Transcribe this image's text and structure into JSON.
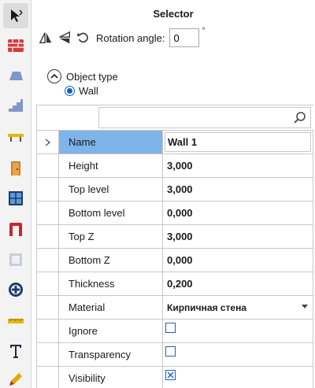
{
  "panel": {
    "title": "Selector"
  },
  "rotation": {
    "label": "Rotation angle:",
    "value": "0",
    "unit": "°"
  },
  "object_type": {
    "label": "Object type",
    "selected_option": "Wall"
  },
  "toolbar": {
    "tools": [
      {
        "icon": "selector-arrow-icon",
        "selected": true
      },
      {
        "icon": "brick-wall-icon"
      },
      {
        "icon": "slab-icon"
      },
      {
        "icon": "stairs-icon"
      },
      {
        "icon": "beam-icon"
      },
      {
        "icon": "door-icon"
      },
      {
        "icon": "window-icon"
      },
      {
        "icon": "opening-icon"
      },
      {
        "icon": "room-icon"
      },
      {
        "icon": "column-icon"
      },
      {
        "icon": "dimension-icon"
      },
      {
        "icon": "text-tool-icon"
      },
      {
        "icon": "pencil-icon"
      }
    ]
  },
  "properties": {
    "search_placeholder": "",
    "rows": [
      {
        "name": "Name",
        "value": "Wall 1",
        "kind": "text"
      },
      {
        "name": "Height",
        "value": "3,000",
        "kind": "text"
      },
      {
        "name": "Top level",
        "value": "3,000",
        "kind": "text"
      },
      {
        "name": "Bottom level",
        "value": "0,000",
        "kind": "text"
      },
      {
        "name": "Top Z",
        "value": "3,000",
        "kind": "text"
      },
      {
        "name": "Bottom Z",
        "value": "0,000",
        "kind": "text"
      },
      {
        "name": "Thickness",
        "value": "0,200",
        "kind": "text"
      },
      {
        "name": "Material",
        "value": "Кирпичная стена",
        "kind": "dropdown"
      },
      {
        "name": "Ignore",
        "checked": false,
        "kind": "checkbox"
      },
      {
        "name": "Transparency",
        "checked": false,
        "kind": "checkbox"
      },
      {
        "name": "Visibility",
        "checked": true,
        "kind": "checkbox"
      }
    ]
  },
  "colors": {
    "selected_row": "#7eb4ea",
    "accent": "#0a64c8",
    "brick": "#d23c3c",
    "wood": "#c9822b"
  }
}
